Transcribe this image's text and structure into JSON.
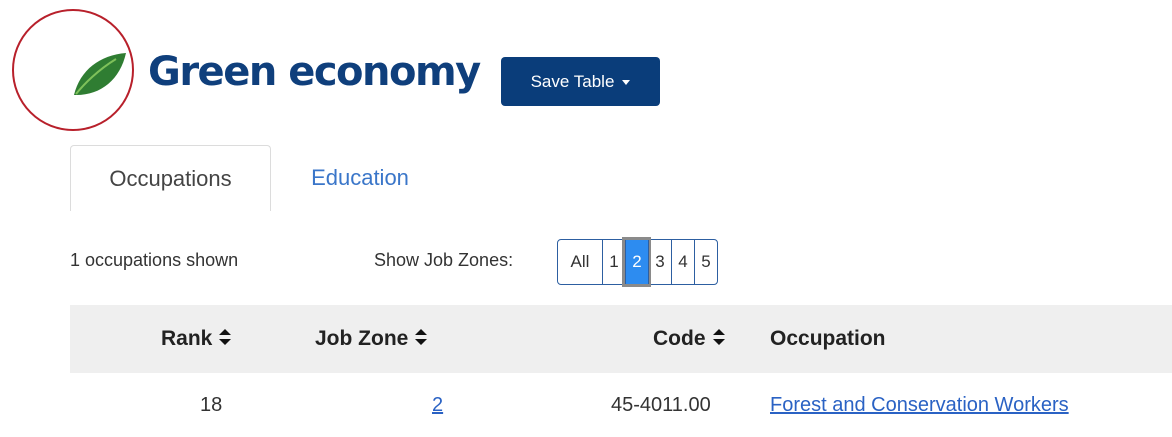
{
  "header": {
    "title": "Green economy",
    "save_label": "Save Table",
    "brand_color": "#0f3f7c",
    "leaf_icon": "leaf-icon"
  },
  "tabs": [
    {
      "label": "Occupations",
      "active": true
    },
    {
      "label": "Education",
      "active": false
    }
  ],
  "filters": {
    "shown_text": "1 occupations shown",
    "zones_label": "Show Job Zones:",
    "zones": [
      "All",
      "1",
      "2",
      "3",
      "4",
      "5"
    ],
    "active_zone": "2"
  },
  "table": {
    "columns": {
      "rank": "Rank",
      "job_zone": "Job Zone",
      "code": "Code",
      "occupation": "Occupation"
    },
    "rows": [
      {
        "rank": "18",
        "job_zone": "2",
        "code": "45-4011.00",
        "occupation": "Forest and Conservation Workers"
      }
    ]
  }
}
